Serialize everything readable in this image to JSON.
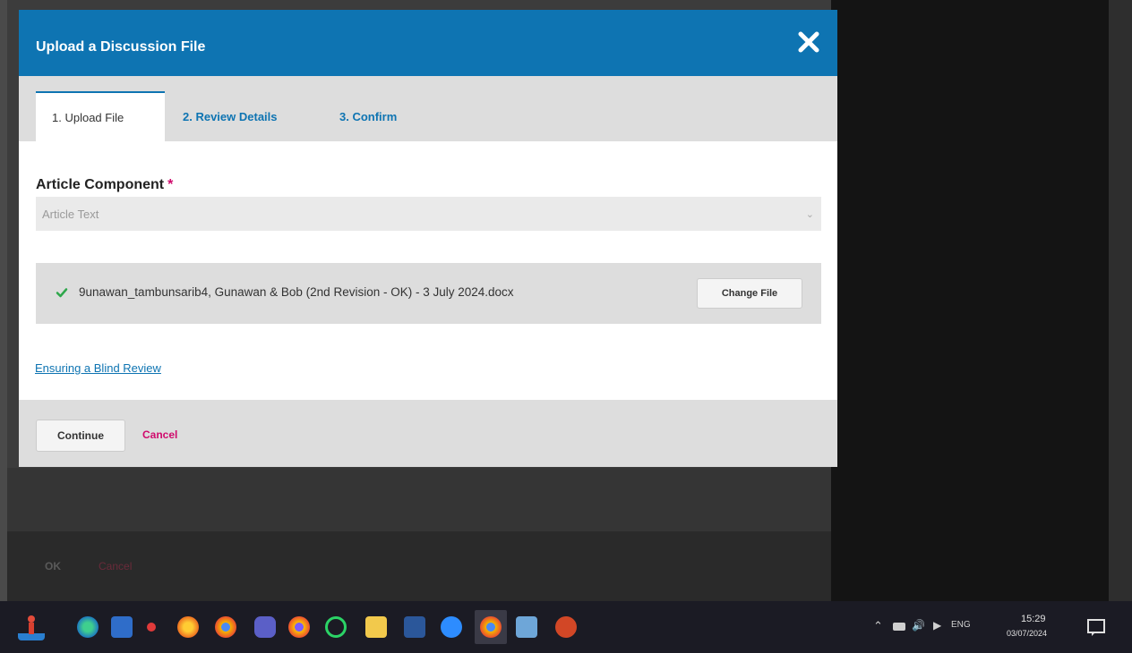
{
  "modal": {
    "title": "Upload a Discussion File",
    "tabs": [
      {
        "label": "1. Upload File",
        "active": true
      },
      {
        "label": "2. Review Details",
        "active": false
      },
      {
        "label": "3. Confirm",
        "active": false
      }
    ],
    "component": {
      "label": "Article Component",
      "required_mark": "*",
      "selected_value": "Article Text"
    },
    "file": {
      "name": "9unawan_tambunsarib4, Gunawan & Bob (2nd Revision - OK) - 3 July 2024.docx",
      "change_label": "Change File"
    },
    "blind_review_link": "Ensuring a Blind Review",
    "footer": {
      "continue_label": "Continue",
      "cancel_label": "Cancel"
    }
  },
  "background": {
    "ok_label": "OK",
    "cancel_label": "Cancel"
  },
  "taskbar": {
    "apps": [
      "person-launcher-icon",
      "edge-browser-icon",
      "store-icon",
      "dot-icon",
      "firefox-icon",
      "chrome-icon",
      "teams-icon",
      "chrome-profile-icon",
      "whatsapp-icon",
      "file-explorer-icon",
      "word-icon",
      "zoom-icon",
      "chrome-active-icon",
      "notepad-icon",
      "powerpoint-icon"
    ],
    "tray": {
      "language": "ENG",
      "time": "15:29",
      "date": "03/07/2024"
    }
  },
  "colors": {
    "primary": "#0e74b2",
    "accent_pink": "#d00a6c",
    "check_green": "#2ea74b"
  }
}
